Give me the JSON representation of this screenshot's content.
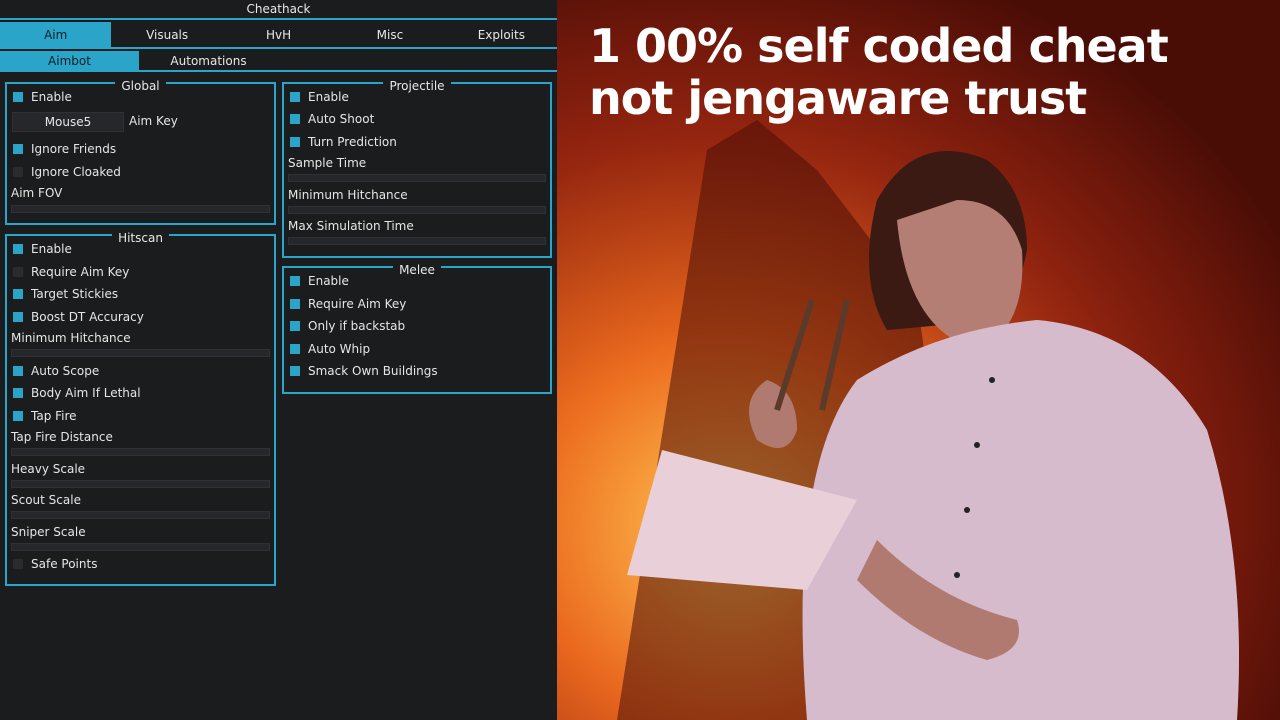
{
  "window": {
    "title": "Cheathack"
  },
  "main_tabs": [
    {
      "label": "Aim",
      "active": true
    },
    {
      "label": "Visuals",
      "active": false
    },
    {
      "label": "HvH",
      "active": false
    },
    {
      "label": "Misc",
      "active": false
    },
    {
      "label": "Exploits",
      "active": false
    }
  ],
  "sub_tabs": [
    {
      "label": "Aimbot",
      "active": true
    },
    {
      "label": "Automations",
      "active": false
    }
  ],
  "global": {
    "title": "Global",
    "enable": {
      "label": "Enable",
      "checked": true
    },
    "aim_key_value": "Mouse5",
    "aim_key_label": "Aim Key",
    "ignore_friends": {
      "label": "Ignore Friends",
      "checked": true
    },
    "ignore_cloaked": {
      "label": "Ignore Cloaked",
      "checked": false
    },
    "aim_fov_label": "Aim FOV"
  },
  "hitscan": {
    "title": "Hitscan",
    "enable": {
      "label": "Enable",
      "checked": true
    },
    "require_aim_key": {
      "label": "Require Aim Key",
      "checked": false
    },
    "target_stickies": {
      "label": "Target Stickies",
      "checked": true
    },
    "boost_dt_accuracy": {
      "label": "Boost DT Accuracy",
      "checked": true
    },
    "minimum_hitchance_label": "Minimum Hitchance",
    "auto_scope": {
      "label": "Auto Scope",
      "checked": true
    },
    "body_aim_if_lethal": {
      "label": "Body Aim If Lethal",
      "checked": true
    },
    "tap_fire": {
      "label": "Tap Fire",
      "checked": true
    },
    "tap_fire_distance_label": "Tap Fire Distance",
    "heavy_scale_label": "Heavy Scale",
    "scout_scale_label": "Scout Scale",
    "sniper_scale_label": "Sniper Scale",
    "safe_points": {
      "label": "Safe Points",
      "checked": false
    }
  },
  "projectile": {
    "title": "Projectile",
    "enable": {
      "label": "Enable",
      "checked": true
    },
    "auto_shoot": {
      "label": "Auto Shoot",
      "checked": true
    },
    "turn_prediction": {
      "label": "Turn Prediction",
      "checked": true
    },
    "sample_time_label": "Sample Time",
    "minimum_hitchance_label": "Minimum Hitchance",
    "max_simulation_time_label": "Max Simulation Time"
  },
  "melee": {
    "title": "Melee",
    "enable": {
      "label": "Enable",
      "checked": true
    },
    "require_aim_key": {
      "label": "Require Aim Key",
      "checked": true
    },
    "only_if_backstab": {
      "label": "Only if backstab",
      "checked": true
    },
    "auto_whip": {
      "label": "Auto Whip",
      "checked": true
    },
    "smack_own_buildings": {
      "label": "Smack Own Buildings",
      "checked": true
    }
  },
  "meme": {
    "caption_line1": "1 00% self coded cheat",
    "caption_line2": "not jengaware trust"
  },
  "colors": {
    "accent": "#2aa4c8",
    "background": "#1b1c1e"
  }
}
